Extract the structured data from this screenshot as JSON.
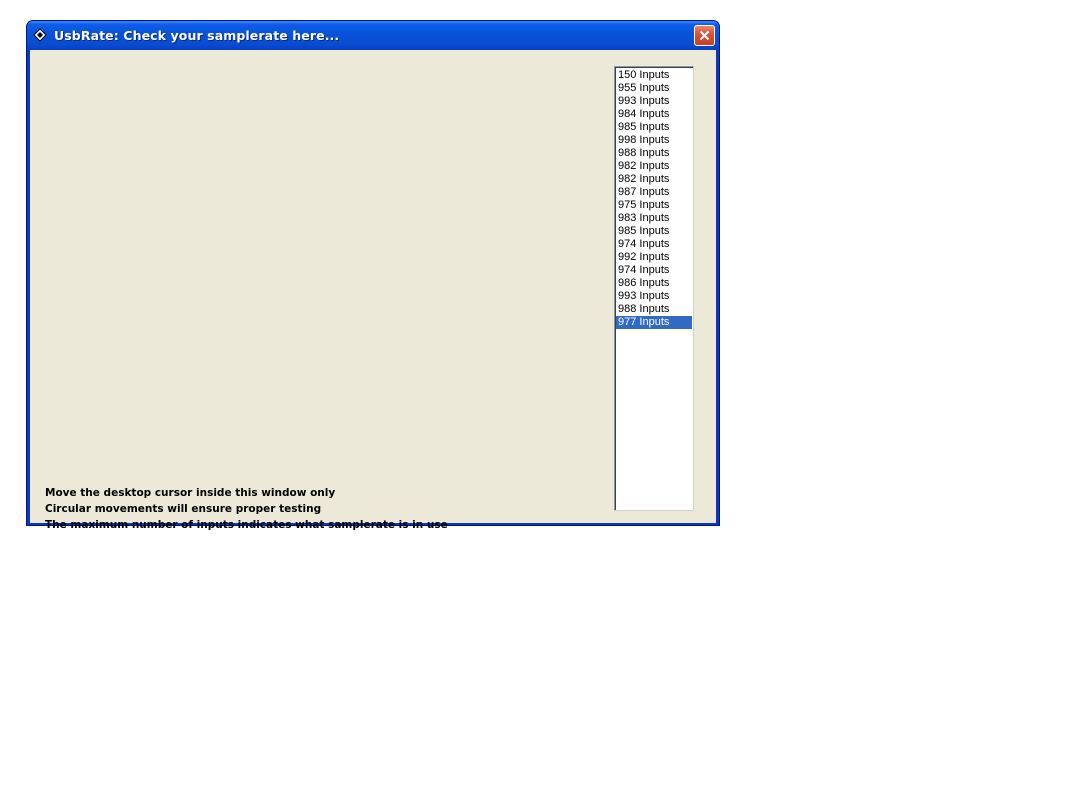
{
  "window": {
    "title": "UsbRate: Check your samplerate here...",
    "app_icon": "diamond-app-icon",
    "close_icon": "close-icon"
  },
  "inputs_list": {
    "items": [
      "150 Inputs",
      "955 Inputs",
      "993 Inputs",
      "984 Inputs",
      "985 Inputs",
      "998 Inputs",
      "988 Inputs",
      "982 Inputs",
      "982 Inputs",
      "987 Inputs",
      "975 Inputs",
      "983 Inputs",
      "985 Inputs",
      "974 Inputs",
      "992 Inputs",
      "974 Inputs",
      "986 Inputs",
      "993 Inputs",
      "988 Inputs",
      "977 Inputs"
    ],
    "selected_index": 19
  },
  "instructions": {
    "line1": "Move the desktop cursor inside this window only",
    "line2": "Circular movements will ensure proper testing",
    "line3": "The maximum number of inputs indicates what samplerate is in use"
  },
  "colors": {
    "title_bar": "#0a4cd0",
    "client_background": "#ece9d8",
    "selection": "#316ac5",
    "close_button": "#d8553a"
  }
}
